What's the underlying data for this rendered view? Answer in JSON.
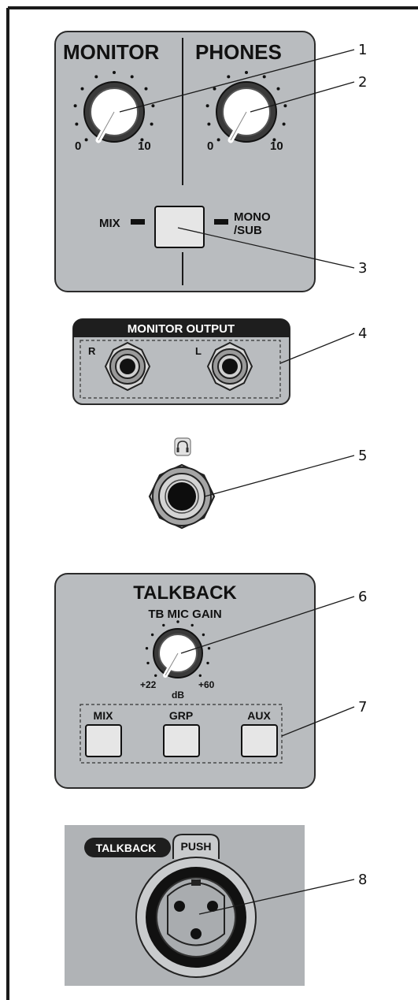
{
  "monitor_section": {
    "monitor_label": "MONITOR",
    "phones_label": "PHONES",
    "monitor_knob": {
      "min_label": "0",
      "max_label": "10"
    },
    "phones_knob": {
      "min_label": "0",
      "max_label": "10"
    },
    "mix_label": "MIX",
    "mono_label": "MONO",
    "sub_label": "/SUB"
  },
  "monitor_output": {
    "title": "MONITOR OUTPUT",
    "right_label": "R",
    "left_label": "L"
  },
  "talkback_section": {
    "title": "TALKBACK",
    "gain_label": "TB MIC GAIN",
    "knob_min": "+22",
    "knob_max": "+60",
    "knob_unit": "dB",
    "buttons": [
      "MIX",
      "GRP",
      "AUX"
    ]
  },
  "talkback_mic": {
    "label": "TALKBACK",
    "push_label": "PUSH"
  },
  "callouts": [
    "1",
    "2",
    "3",
    "4",
    "5",
    "6",
    "7",
    "8"
  ],
  "colors": {
    "panel": "#b9bcbf",
    "panel_border": "#2b2b2b",
    "callout_line": "#1a1a1a"
  }
}
